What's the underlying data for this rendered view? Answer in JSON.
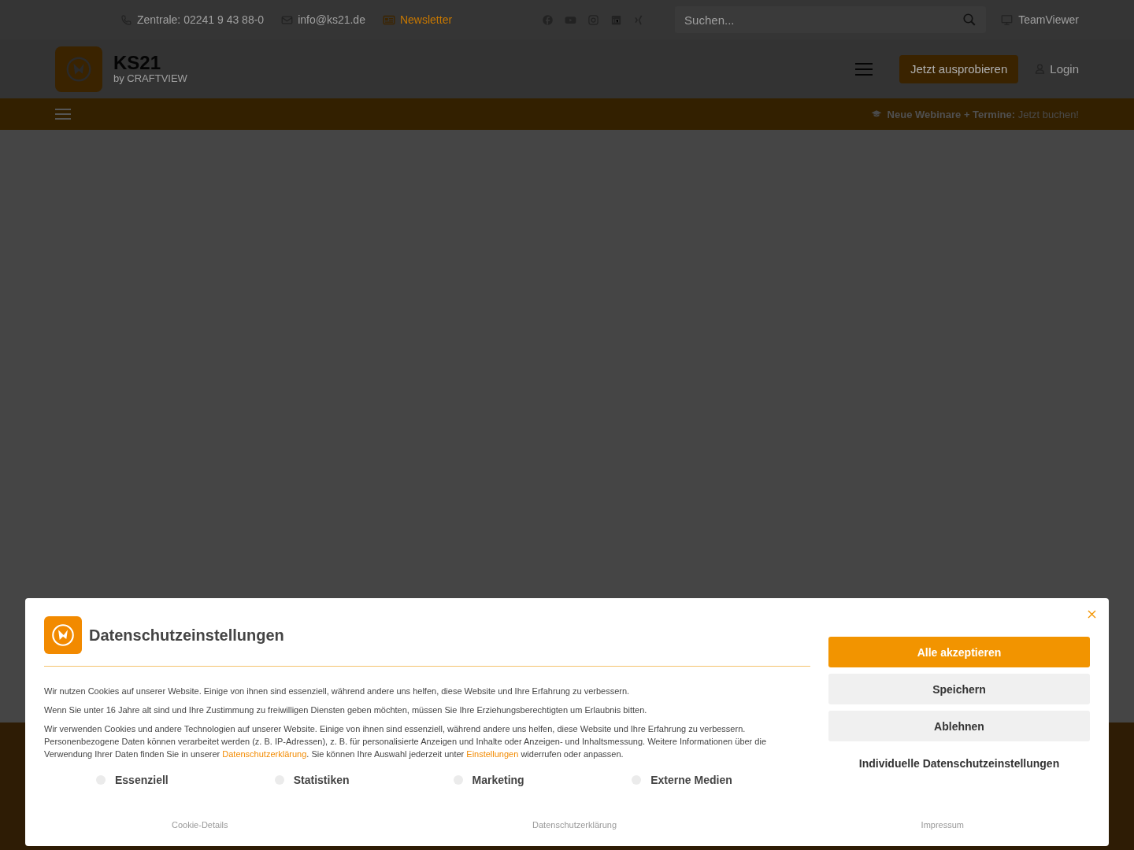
{
  "topbar": {
    "contacts": [
      {
        "kind": "phone",
        "text": "Zentrale: 02241 9 43 88-0"
      },
      {
        "kind": "email",
        "text": "info@ks21.de"
      },
      {
        "kind": "newsletter",
        "text": "Newsletter"
      }
    ],
    "search": {
      "placeholder": "Suchen..."
    },
    "remote": "TeamViewer"
  },
  "header": {
    "brand": "KS21",
    "subtitle": "by CRAFTVIEW",
    "cta": "Jetzt ausprobieren",
    "login": "Login"
  },
  "banner": {
    "text": "**Neue Webinare + Termine:** Jetzt buchen!"
  },
  "cookie_dialog": {
    "title": "Datenschutzeinstellungen",
    "paragraphs": [
      {
        "parts": [
          {
            "kind": "text",
            "text": "Wir nutzen Cookies auf unserer Website. Einige von ihnen sind essenziell, während andere uns helfen, diese Website und Ihre Erfahrung zu verbessern."
          }
        ]
      },
      {
        "parts": [
          {
            "kind": "text",
            "text": "Wenn Sie unter 16 Jahre alt sind und Ihre Zustimmung zu freiwilligen Diensten geben möchten, müssen Sie Ihre Erziehungsberechtigten um Erlaubnis bitten."
          }
        ]
      },
      {
        "parts": [
          {
            "kind": "text",
            "text": "Wir verwenden Cookies und andere Technologien auf unserer Website. Einige von ihnen sind essenziell, während andere uns helfen, diese Website und Ihre Erfahrung zu verbessern. Personenbezogene Daten können verarbeitet werden (z. B. IP-Adressen), z. B. für personalisierte Anzeigen und Inhalte oder Anzeigen- und Inhaltsmessung. Weitere Informationen über die Verwendung Ihrer Daten finden Sie in unserer "
          },
          {
            "kind": "link",
            "text": "Datenschutzerklärung"
          },
          {
            "kind": "text",
            "text": ". Sie können Ihre Auswahl jederzeit unter "
          },
          {
            "kind": "link",
            "text": "Einstellungen"
          },
          {
            "kind": "text",
            "text": " widerrufen oder anpassen."
          }
        ]
      }
    ],
    "categories": [
      {
        "label": "Essenziell",
        "checked": false
      },
      {
        "label": "Statistiken",
        "checked": false
      },
      {
        "label": "Marketing",
        "checked": false
      },
      {
        "label": "Externe Medien",
        "checked": false
      }
    ],
    "buttons": [
      {
        "kind": "primary",
        "label": "Alle akzeptieren"
      },
      {
        "kind": "secondary",
        "label": "Speichern"
      },
      {
        "kind": "secondary",
        "label": "Ablehnen"
      },
      {
        "kind": "plain",
        "label": "Individuelle Datenschutzeinstellungen"
      }
    ],
    "footer_links": [
      "Cookie-Details",
      "Datenschutzerklärung",
      "Impressum"
    ]
  }
}
